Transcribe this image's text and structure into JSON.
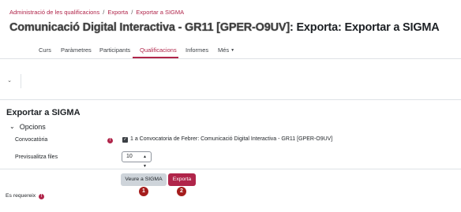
{
  "breadcrumb": {
    "items": [
      "Administració de les qualificacions",
      "Exporta",
      "Exportar a SIGMA"
    ],
    "separator": "/"
  },
  "header": {
    "course_title": "Comunicació Digital Interactiva - GR11 [GPER-O9UV]",
    "title_suffix": ": Exporta: Exportar a SIGMA"
  },
  "tabs": [
    {
      "label": "Curs",
      "active": false
    },
    {
      "label": "Paràmetres",
      "active": false
    },
    {
      "label": "Participants",
      "active": false
    },
    {
      "label": "Qualificacions",
      "active": true
    },
    {
      "label": "Informes",
      "active": false
    },
    {
      "label": "Més",
      "active": false
    }
  ],
  "action_bar": {
    "collapse_icon": "chevron-down-icon"
  },
  "main": {
    "section_title": "Exportar a SIGMA",
    "fieldset_title": "Opcions",
    "fields": {
      "convocatoria": {
        "label": "Convocatòria",
        "option_label": "1 a Convocatoria de Febrer: Comunicació Digital Interactiva - GR11 [GPER-O9UV]",
        "checked": true
      },
      "preview_rows": {
        "label": "Previsualitza files",
        "value": "10"
      }
    },
    "buttons": {
      "preview": "Veure a SIGMA",
      "export": "Exporta"
    },
    "required_note": "Es requereix"
  },
  "markers": [
    "1",
    "2"
  ],
  "colors": {
    "accent": "#b0254a",
    "marker": "#a51d1d",
    "secondary_button": "#ced4da"
  }
}
